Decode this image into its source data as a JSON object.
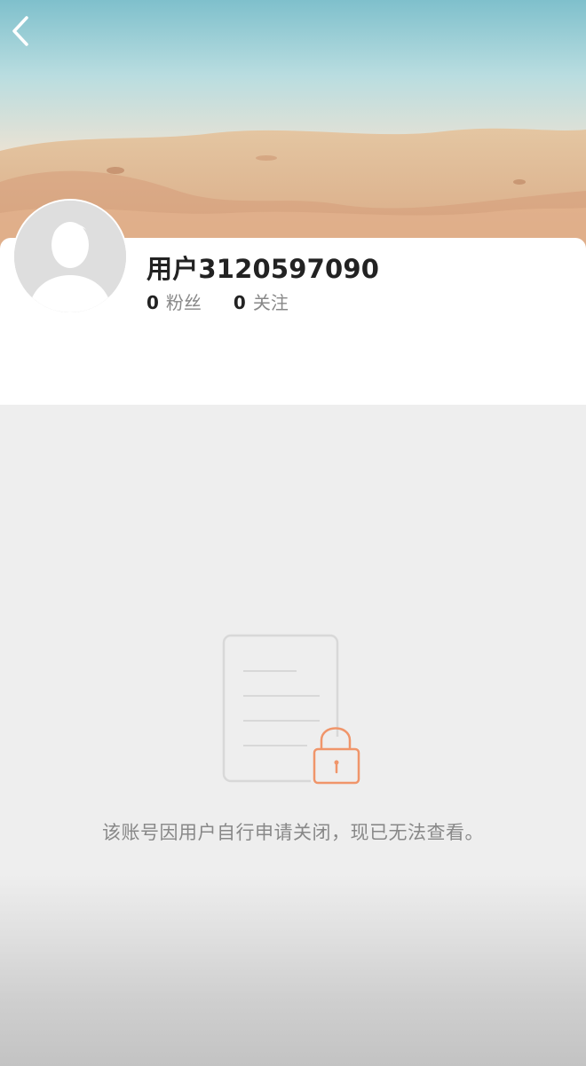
{
  "profile": {
    "username": "用户3120597090",
    "fans_count": "0",
    "fans_label": "粉丝",
    "following_count": "0",
    "following_label": "关注"
  },
  "notice": {
    "text": "该账号因用户自行申请关闭，现已无法查看。"
  },
  "icons": {
    "back": "chevron-left-icon",
    "avatar": "default-user-avatar",
    "locked": "locked-document-icon"
  },
  "colors": {
    "accent_orange": "#f0956a",
    "text_primary": "#222222",
    "text_secondary": "#888888",
    "empty_background": "#eeeeee"
  }
}
